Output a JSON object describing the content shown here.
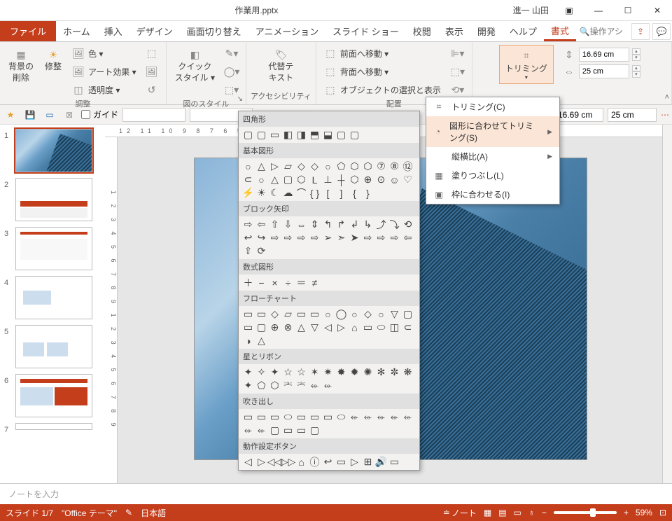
{
  "title": "作業用.pptx",
  "user": "進一 山田",
  "tabs": [
    "ファイル",
    "ホーム",
    "挿入",
    "デザイン",
    "画面切り替え",
    "アニメーション",
    "スライド ショー",
    "校閲",
    "表示",
    "開発",
    "ヘルプ",
    "書式"
  ],
  "active_tab": "書式",
  "search_placeholder": "操作アシ",
  "ribbon": {
    "g1_label": "調整",
    "g1_btn1": "背景の\n削除",
    "g1_btn2": "修整",
    "g1_i1": "色 ▾",
    "g1_i2": "アート効果 ▾",
    "g1_i3": "透明度 ▾",
    "g2_label": "図のスタイル",
    "g2_btn": "クイック\nスタイル ▾",
    "g3_label": "アクセシビリティ",
    "g3_btn": "代替テ\nキスト",
    "g4_label": "配置",
    "g4_i1": "前面へ移動 ▾",
    "g4_i2": "背面へ移動 ▾",
    "g4_i3": "オブジェクトの選択と表示",
    "trim_label": "トリミング",
    "height": "16.69 cm",
    "width": "25 cm"
  },
  "qat": {
    "guide": "ガイド",
    "w": "16.69 cm",
    "h": "25 cm"
  },
  "trim_menu": {
    "m1": "トリミング(C)",
    "m2": "図形に合わせてトリミング(S)",
    "m3": "縦横比(A)",
    "m4": "塗りつぶし(L)",
    "m5": "枠に合わせる(I)"
  },
  "shapes": {
    "c1": "四角形",
    "c2": "基本図形",
    "c3": "ブロック矢印",
    "c4": "数式図形",
    "c5": "フローチャート",
    "c6": "星とリボン",
    "c7": "吹き出し",
    "c8": "動作設定ボタン"
  },
  "shape_glyphs": {
    "rects": [
      "▢",
      "▢",
      "▭",
      "◧",
      "◨",
      "⬒",
      "⬓",
      "▢",
      "▢"
    ],
    "basic": [
      "○",
      "△",
      "▷",
      "▱",
      "◇",
      "◇",
      "○",
      "⬠",
      "⬡",
      "⬡",
      "⑦",
      "⑧",
      "⑫",
      "⊂",
      "○",
      "△",
      "▢",
      "⬡",
      "L",
      "⊥",
      "┼",
      "⬡",
      "⊕",
      "⊙",
      "☺",
      "♡",
      "⚡",
      "☀",
      "☾",
      "☁",
      "⌒",
      "{ }",
      "[",
      "]",
      "{",
      "}"
    ],
    "arrows": [
      "⇨",
      "⇦",
      "⇧",
      "⇩",
      "⇔",
      "⇕",
      "↰",
      "↱",
      "↲",
      "↳",
      "⤴",
      "⤵",
      "⟲",
      "↩",
      "↪",
      "⇨",
      "⇨",
      "⇨",
      "⇨",
      "➢",
      "➣",
      "➤",
      "⇨",
      "⇨",
      "⇨",
      "⇦",
      "⇧",
      "⟳"
    ],
    "math": [
      "＋",
      "−",
      "×",
      "÷",
      "＝",
      "≠"
    ],
    "flow": [
      "▭",
      "▭",
      "◇",
      "▱",
      "▭",
      "▭",
      "○",
      "◯",
      "○",
      "◇",
      "○",
      "▽",
      "▢",
      "▭",
      "▢",
      "⊕",
      "⊗",
      "△",
      "▽",
      "◁",
      "▷",
      "⌂",
      "▭",
      "⬭",
      "◫",
      "⊂",
      "◑",
      "△"
    ],
    "stars": [
      "✦",
      "✧",
      "✦",
      "☆",
      "☆",
      "✶",
      "✷",
      "✸",
      "✹",
      "✺",
      "✻",
      "✼",
      "❋",
      "✦",
      "⬠",
      "⬡",
      "⎃",
      "⎃",
      "⬰",
      "⬰"
    ],
    "callouts": [
      "▭",
      "▭",
      "▭",
      "⬭",
      "▭",
      "▭",
      "▭",
      "⬭",
      "⬰",
      "⬰",
      "⬰",
      "⬰",
      "⬰",
      "⬰",
      "⬰",
      "▢",
      "▭",
      "▭",
      "▢"
    ],
    "actions": [
      "◁",
      "▷",
      "◁◁",
      "▷▷",
      "⌂",
      "ⓘ",
      "↩",
      "▭",
      "▷",
      "⊞",
      "🔊",
      "▭"
    ]
  },
  "ruler_h": "12 11 10 9 8 7 6 5 4 3 2 1 0 1 2 3 4 5 6 7 8 9 10 11 12",
  "ruler_v": "1 2 3 4 5 6 7 8 9 1 2 3 4 5 6 7 8 9",
  "notes_placeholder": "ノートを入力",
  "status": {
    "slide": "スライド 1/7",
    "theme": "\"Office テーマ\"",
    "lang": "日本語",
    "notes": "ノート",
    "zoom": "59%"
  },
  "thumbs": 7
}
